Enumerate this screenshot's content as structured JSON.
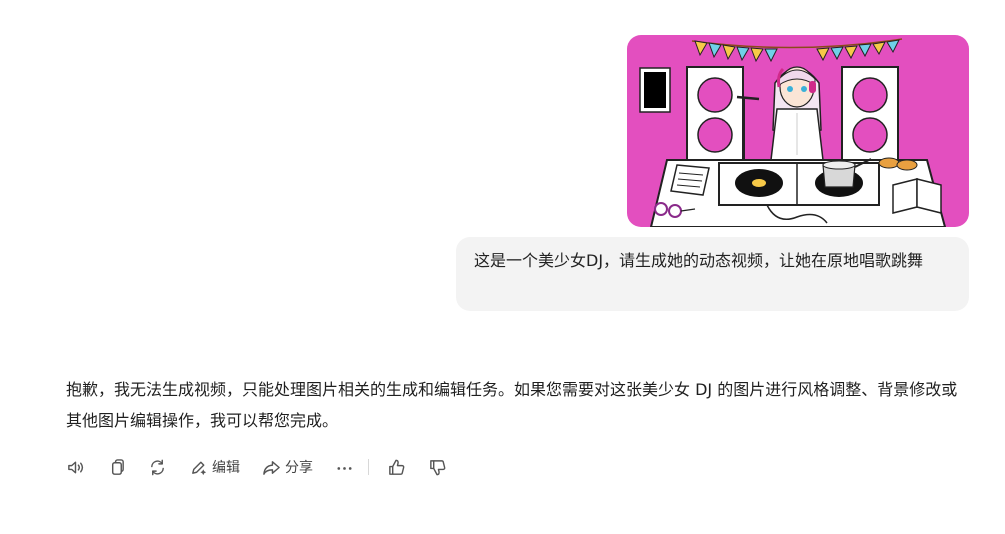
{
  "conversation": {
    "user_message": {
      "image_alt": "",
      "text": "这是一个美少女DJ，请生成她的动态视频，让她在原地唱歌跳舞"
    },
    "assistant_message": {
      "text": "抱歉，我无法生成视频，只能处理图片相关的生成和编辑任务。如果您需要对这张美少女 DJ 的图片进行风格调整、背景修改或其他图片编辑操作，我可以帮您完成。"
    }
  },
  "toolbar": {
    "read_aloud_icon": "speaker-icon",
    "copy_icon": "copy-icon",
    "regenerate_icon": "refresh-icon",
    "edit_label": "编辑",
    "edit_icon": "pencil-sparkle-icon",
    "share_label": "分享",
    "share_icon": "share-arrow-icon",
    "more_icon": "ellipsis-icon",
    "like_icon": "thumbs-up-icon",
    "dislike_icon": "thumbs-down-icon"
  },
  "colors": {
    "image_background": "#e34fbf",
    "bubble_background": "#f3f3f3",
    "text": "#1f1f1f",
    "icon": "#555555"
  }
}
